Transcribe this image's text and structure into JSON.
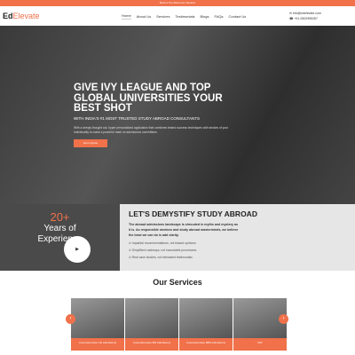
{
  "topbar": {
    "text": "Book a Pre-Discovery Session"
  },
  "logo": {
    "part1": "Ed",
    "part2": "Elevate"
  },
  "nav": {
    "items": [
      "Home",
      "About Us",
      "Services",
      "Testimonials",
      "Blogs",
      "FAQs",
      "Contact Us"
    ]
  },
  "contact": {
    "email": "info@edelevate.com",
    "phone": "+91-9302955287"
  },
  "hero": {
    "title": "GIVE IVY LEAGUE AND TOP GLOBAL UNIVERSITIES YOUR BEST SHOT",
    "subtitle": "WITH INDIA'S #1 MOST TRUSTED STUDY ABROAD CONSULTANTS",
    "description": "With a deeply thought out, hyper personalized application that combines tested success techniques with strokes of your individuality to make a powerful mark on admissions committees.",
    "button": "Get a Quote"
  },
  "experience": {
    "number": "20+",
    "text": "Years of Experience"
  },
  "demystify": {
    "title": "LET'S DEMYSTIFY STUDY ABROAD",
    "intro": "The abroad admissions landscape is shrouded in myths and mystery as it is. As responsible mentors and study abroad masterminds, we believe the least we can do is add clarity.",
    "points": [
      "Impartial recommendations, not biased opinions",
      "Simplified roadmaps, not inscrutable procedures",
      "Real case studies, not fabricated testimonials"
    ]
  },
  "services": {
    "title": "Our Services",
    "cards": [
      "Comprehensive UG Admissions",
      "Comprehensive MS Admissions",
      "Comprehensive MBA Admissions",
      "SAT"
    ]
  },
  "colors": {
    "accent": "#f0714a"
  }
}
